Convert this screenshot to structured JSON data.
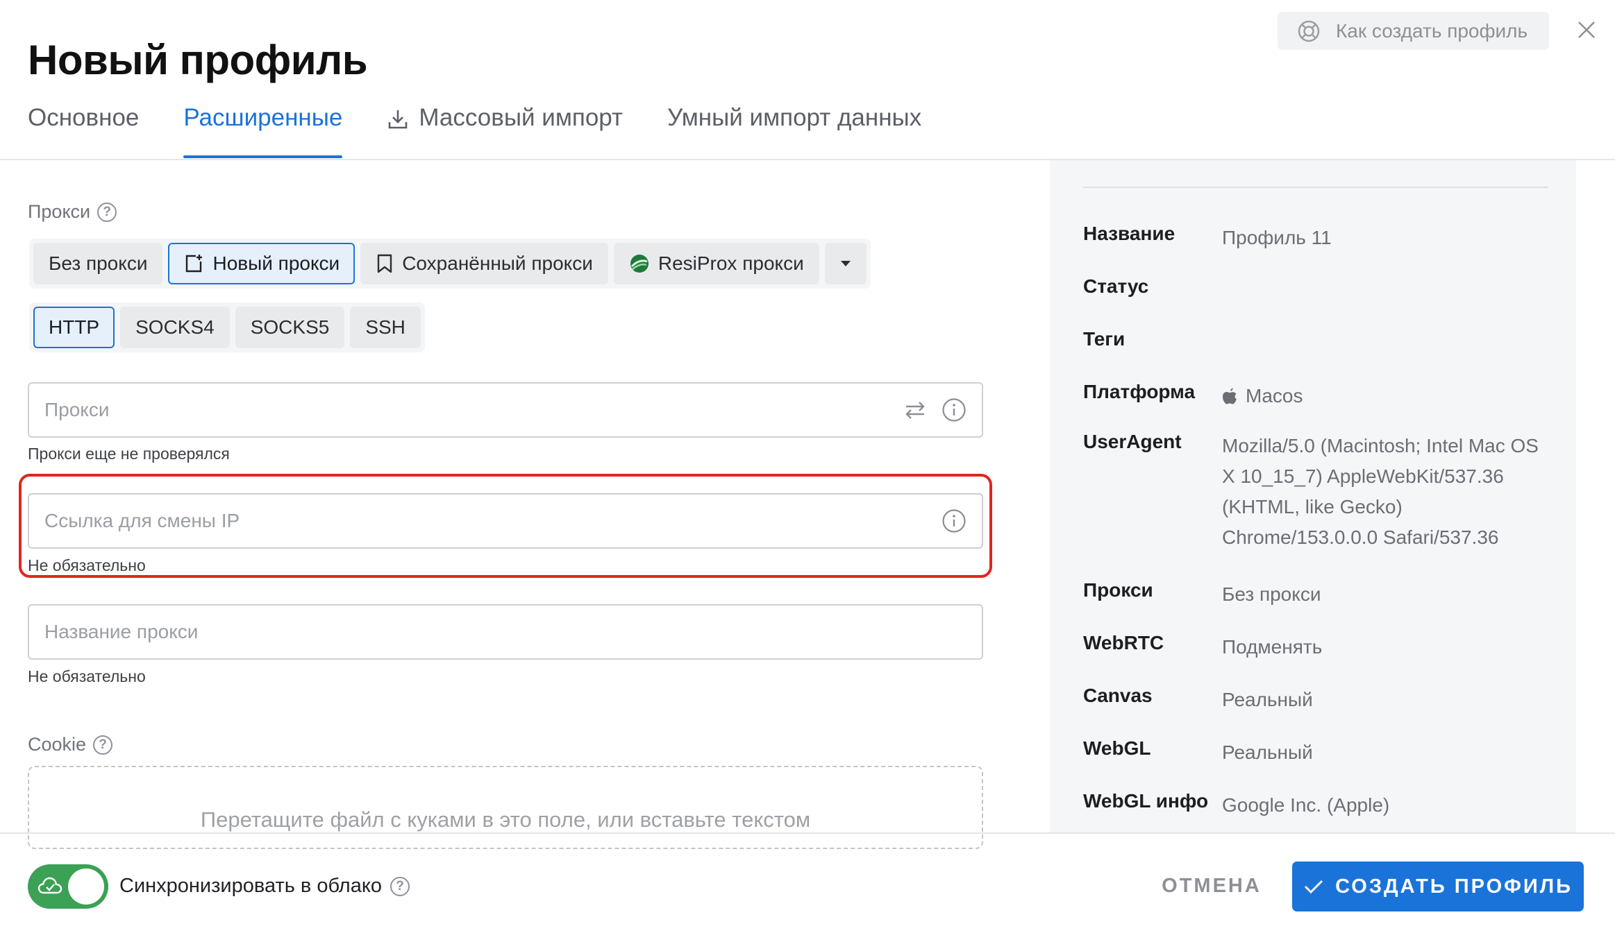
{
  "header": {
    "title": "Новый профиль",
    "help_button_label": "Как создать профиль"
  },
  "tabs": [
    {
      "label": "Основное",
      "active": false
    },
    {
      "label": "Расширенные",
      "active": true
    },
    {
      "label": "Массовый импорт",
      "active": false,
      "icon": "download-icon"
    },
    {
      "label": "Умный импорт данных",
      "active": false
    }
  ],
  "proxy": {
    "section_label": "Прокси",
    "mode_options": [
      "Без прокси",
      "Новый прокси",
      "Сохранённый прокси",
      "ResiProx прокси"
    ],
    "mode_selected": "Новый прокси",
    "protocols": [
      "HTTP",
      "SOCKS4",
      "SOCKS5",
      "SSH"
    ],
    "protocol_selected": "HTTP",
    "proxy_field_placeholder": "Прокси",
    "proxy_field_hint": "Прокси еще не проверялся",
    "ip_change_placeholder": "Ссылка для смены IP",
    "ip_change_hint": "Не обязательно",
    "name_placeholder": "Название прокси",
    "name_hint": "Не обязательно"
  },
  "cookie": {
    "section_label": "Cookie",
    "dropzone_text": "Перетащите файл с куками в это поле, или вставьте текстом"
  },
  "summary": [
    {
      "key": "Название",
      "value": "Профиль 11"
    },
    {
      "key": "Статус",
      "value": ""
    },
    {
      "key": "Теги",
      "value": ""
    },
    {
      "key": "Платформа",
      "value": "Macos",
      "icon": "apple-icon"
    },
    {
      "key": "UserAgent",
      "value": "Mozilla/5.0 (Macintosh; Intel Mac OS X 10_15_7) AppleWebKit/537.36 (KHTML, like Gecko) Chrome/153.0.0.0 Safari/537.36"
    },
    {
      "key": "Прокси",
      "value": "Без прокси"
    },
    {
      "key": "WebRTC",
      "value": "Подменять"
    },
    {
      "key": "Canvas",
      "value": "Реальный"
    },
    {
      "key": "WebGL",
      "value": "Реальный"
    },
    {
      "key": "WebGL инфо",
      "value": "Google Inc. (Apple)"
    }
  ],
  "footer": {
    "sync_label": "Синхронизировать в облако",
    "sync_enabled": true,
    "cancel_label": "ОТМЕНА",
    "create_label": "СОЗДАТЬ ПРОФИЛЬ"
  },
  "colors": {
    "accent": "#1a73d9",
    "toggle_on": "#3aa155",
    "highlight": "#e0261d"
  }
}
